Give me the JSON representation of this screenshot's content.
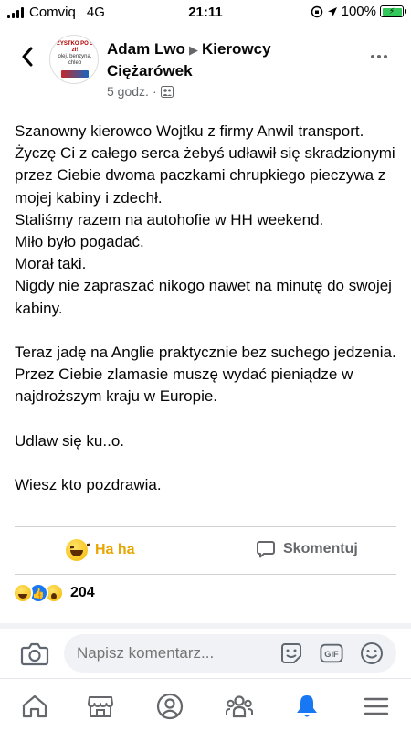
{
  "status_bar": {
    "carrier": "Comviq",
    "network": "4G",
    "time": "21:11",
    "battery": "100%",
    "battery_level": 1.0
  },
  "header": {
    "back_icon": "chevron-left-icon",
    "author": "Adam Lwo",
    "group": "Kierowcy Ciężarówek",
    "time_ago": "5 godz.",
    "separator": "·",
    "audience_icon": "group-icon",
    "avatar_text_line1": "ZYSTKO PO 5 zł!",
    "avatar_text_line2": "olej, benzyna, chleb"
  },
  "post": {
    "paragraphs": [
      "Szanowny kierowco Wojtku z firmy Anwil transport. Życzę Ci z całego serca żebyś udławił się skradzionymi przez Ciebie dwoma paczkami chrupkiego pieczywa z mojej kabiny i zdechł.",
      "Staliśmy razem na autohofie w HH weekend.",
      "Miło było pogadać.",
      "Morał taki.",
      "Nigdy nie zapraszać nikogo nawet na minutę do swojej kabiny.",
      "",
      "Teraz jadę na Anglie praktycznie bez suchego jedzenia.",
      "Przez Ciebie zlamasie muszę wydać pieniądze w najdroższym kraju w Europie.",
      "",
      "Udlaw się ku..o.",
      "",
      "Wiesz kto pozdrawia."
    ]
  },
  "actions": {
    "reaction_label": "Ha ha",
    "comment_label": "Skomentuj",
    "reaction_color": "#e8a700"
  },
  "reactions": {
    "count": "204",
    "types": [
      "haha",
      "like",
      "wow"
    ]
  },
  "comment_box": {
    "placeholder": "Napisz komentarz..."
  },
  "nav": {
    "items": [
      "home-icon",
      "marketplace-icon",
      "profile-icon",
      "groups-icon",
      "notifications-icon",
      "menu-icon"
    ],
    "active": "notifications-icon",
    "active_color": "#1877f2"
  }
}
